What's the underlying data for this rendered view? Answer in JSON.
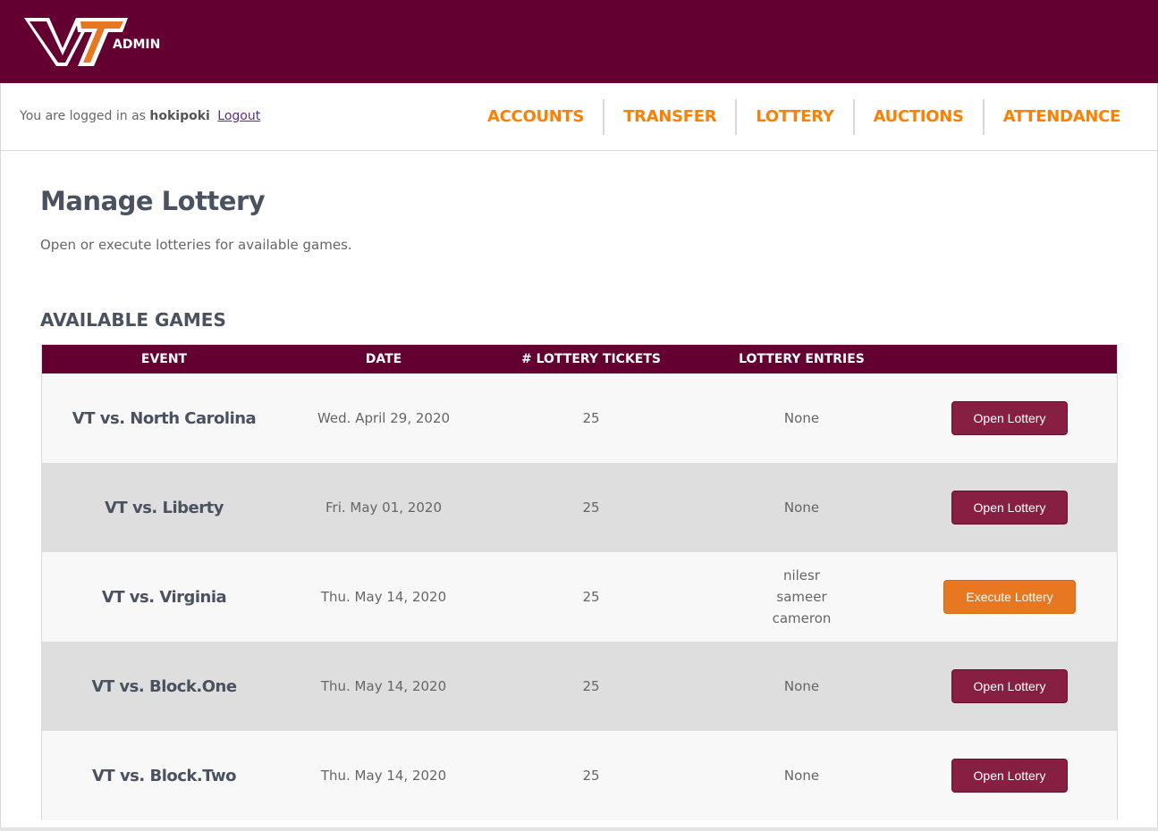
{
  "header": {
    "logo": "vt-logo",
    "admin_label": "ADMIN"
  },
  "navbar": {
    "login_prefix": "You are logged in as",
    "username": "hokipoki",
    "logout_label": "Logout",
    "links": [
      "ACCOUNTS",
      "TRANSFER",
      "LOTTERY",
      "AUCTIONS",
      "ATTENDANCE"
    ]
  },
  "main": {
    "title": "Manage Lottery",
    "subtitle": "Open or execute lotteries for available games.",
    "section_title": "AVAILABLE GAMES"
  },
  "table": {
    "headers": [
      "EVENT",
      "DATE",
      "# LOTTERY TICKETS",
      "LOTTERY ENTRIES",
      ""
    ],
    "rows": [
      {
        "event": "VT vs. North Carolina",
        "date": "Wed. April 29, 2020",
        "tickets": "25",
        "entries": [
          "None"
        ],
        "action": "Open Lottery"
      },
      {
        "event": "VT vs. Liberty",
        "date": "Fri. May 01, 2020",
        "tickets": "25",
        "entries": [
          "None"
        ],
        "action": "Open Lottery"
      },
      {
        "event": "VT vs. Virginia",
        "date": "Thu. May 14, 2020",
        "tickets": "25",
        "entries": [
          "nilesr",
          "sameer",
          "cameron"
        ],
        "action": "Execute Lottery"
      },
      {
        "event": "VT vs. Block.One",
        "date": "Thu. May 14, 2020",
        "tickets": "25",
        "entries": [
          "None"
        ],
        "action": "Open Lottery"
      },
      {
        "event": "VT vs. Block.Two",
        "date": "Thu. May 14, 2020",
        "tickets": "25",
        "entries": [
          "None"
        ],
        "action": "Open Lottery"
      }
    ]
  },
  "colors": {
    "maroon": "#630031",
    "orange": "#ff7f00",
    "button_maroon": "#861f41",
    "button_orange": "#e87722"
  }
}
